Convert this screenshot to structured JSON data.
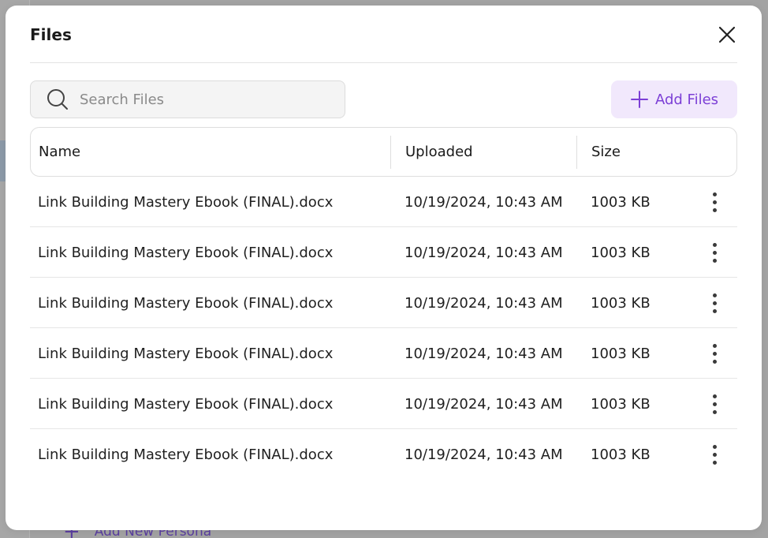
{
  "background": {
    "bottom_link_label": "Add New Persona"
  },
  "modal": {
    "title": "Files",
    "search": {
      "placeholder": "Search Files",
      "value": ""
    },
    "add_button_label": "Add Files",
    "table": {
      "columns": [
        "Name",
        "Uploaded",
        "Size"
      ],
      "rows": [
        {
          "name": "Link Building Mastery Ebook (FINAL).docx",
          "uploaded": "10/19/2024, 10:43 AM",
          "size": "1003 KB"
        },
        {
          "name": "Link Building Mastery Ebook (FINAL).docx",
          "uploaded": "10/19/2024, 10:43 AM",
          "size": "1003 KB"
        },
        {
          "name": "Link Building Mastery Ebook (FINAL).docx",
          "uploaded": "10/19/2024, 10:43 AM",
          "size": "1003 KB"
        },
        {
          "name": "Link Building Mastery Ebook (FINAL).docx",
          "uploaded": "10/19/2024, 10:43 AM",
          "size": "1003 KB"
        },
        {
          "name": "Link Building Mastery Ebook (FINAL).docx",
          "uploaded": "10/19/2024, 10:43 AM",
          "size": "1003 KB"
        },
        {
          "name": "Link Building Mastery Ebook (FINAL).docx",
          "uploaded": "10/19/2024, 10:43 AM",
          "size": "1003 KB"
        }
      ]
    }
  },
  "icons": {
    "close": "close-icon",
    "search": "search-icon",
    "add": "plus-icon",
    "row_menu": "more-vertical-icon"
  },
  "colors": {
    "accent": "#7c3fd6",
    "accent_bg": "#f1e8fc",
    "overlay": "#a3a3a3"
  }
}
